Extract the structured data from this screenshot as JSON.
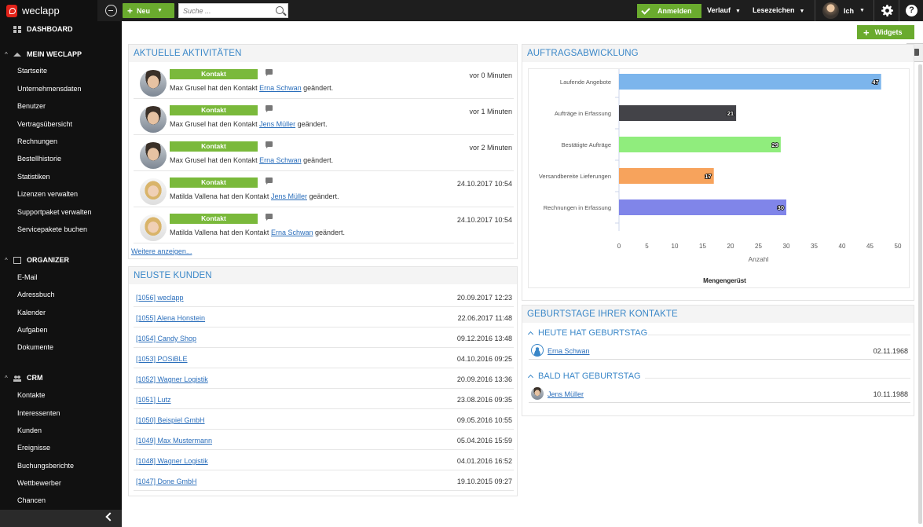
{
  "topbar": {
    "logo_text": "weclapp",
    "new_label": "Neu",
    "search_placeholder": "Suche ...",
    "login_label": "Anmelden",
    "history_label": "Verlauf",
    "bookmarks_label": "Lesezeichen",
    "user_label": "Ich",
    "help_label": "?"
  },
  "sidebar": {
    "dashboard_label": "DASHBOARD",
    "sections": [
      {
        "title": "MEIN WECLAPP",
        "items": [
          "Startseite",
          "Unternehmensdaten",
          "Benutzer",
          "Vertragsübersicht",
          "Rechnungen",
          "Bestellhistorie",
          "Statistiken",
          "Lizenzen verwalten",
          "Supportpaket verwalten",
          "Servicepakete buchen"
        ]
      },
      {
        "title": "ORGANIZER",
        "items": [
          "E-Mail",
          "Adressbuch",
          "Kalender",
          "Aufgaben",
          "Dokumente"
        ]
      },
      {
        "title": "CRM",
        "items": [
          "Kontakte",
          "Interessenten",
          "Kunden",
          "Ereignisse",
          "Buchungsberichte",
          "Wettbewerber",
          "Chancen"
        ]
      }
    ]
  },
  "main": {
    "widgets_label": "Widgets"
  },
  "activities": {
    "title": "AKTUELLE AKTIVITÄTEN",
    "more_label": "Weitere anzeigen...",
    "items": [
      {
        "tag": "Kontakt",
        "time": "vor 0 Minuten",
        "actor": "Max Grusel",
        "text_before": " hat den Kontakt ",
        "contact": "Erna Schwan",
        "text_after": " geändert.",
        "avatar": "male"
      },
      {
        "tag": "Kontakt",
        "time": "vor 1 Minuten",
        "actor": "Max Grusel",
        "text_before": " hat den Kontakt ",
        "contact": "Jens Müller",
        "text_after": " geändert.",
        "avatar": "male"
      },
      {
        "tag": "Kontakt",
        "time": "vor 2 Minuten",
        "actor": "Max Grusel",
        "text_before": " hat den Kontakt ",
        "contact": "Erna Schwan",
        "text_after": " geändert.",
        "avatar": "male"
      },
      {
        "tag": "Kontakt",
        "time": "24.10.2017 10:54",
        "actor": "Matilda Vallena",
        "text_before": " hat den Kontakt ",
        "contact": "Jens Müller",
        "text_after": " geändert.",
        "avatar": "female"
      },
      {
        "tag": "Kontakt",
        "time": "24.10.2017 10:54",
        "actor": "Matilda Vallena",
        "text_before": " hat den Kontakt ",
        "contact": "Erna Schwan",
        "text_after": " geändert.",
        "avatar": "female"
      }
    ]
  },
  "customers": {
    "title": "NEUSTE KUNDEN",
    "rows": [
      {
        "name": "[1056] weclapp",
        "date": "20.09.2017 12:23"
      },
      {
        "name": "[1055] Alena Honstein",
        "date": "22.06.2017 11:48"
      },
      {
        "name": "[1054] Candy Shop",
        "date": "09.12.2016 13:48"
      },
      {
        "name": "[1053] POSiBLE",
        "date": "04.10.2016 09:25"
      },
      {
        "name": "[1052] Wagner Logistik",
        "date": "20.09.2016 13:36"
      },
      {
        "name": "[1051] Lutz",
        "date": "23.08.2016 09:35"
      },
      {
        "name": "[1050] Beispiel GmbH",
        "date": "09.05.2016 10:55"
      },
      {
        "name": "[1049] Max Mustermann",
        "date": "05.04.2016 15:59"
      },
      {
        "name": "[1048] Wagner Logistik",
        "date": "04.01.2016 16:52"
      },
      {
        "name": "[1047] Done GmbH",
        "date": "19.10.2015 09:27"
      }
    ]
  },
  "orders": {
    "title": "AUFTRAGSABWICKLUNG"
  },
  "chart_data": {
    "type": "bar",
    "orientation": "horizontal",
    "categories": [
      "Laufende Angebote",
      "Aufträge in Erfassung",
      "Bestätigte Aufträge",
      "Versandbereite Lieferungen",
      "Rechnungen in Erfassung"
    ],
    "values": [
      47,
      21,
      29,
      17,
      30
    ],
    "colors": [
      "#7cb5ec",
      "#434348",
      "#90ed7d",
      "#f7a35c",
      "#8085e9"
    ],
    "xlabel": "Anzahl",
    "footer": "Mengengerüst",
    "xlim": [
      0,
      50
    ],
    "xticks": [
      0,
      5,
      10,
      15,
      20,
      25,
      30,
      35,
      40,
      45,
      50
    ],
    "data_labels": true,
    "grid": false
  },
  "birthdays": {
    "title": "GEBURTSTAGE IHRER KONTAKTE",
    "today_label": "HEUTE HAT GEBURTSTAG",
    "soon_label": "BALD HAT GEBURTSTAG",
    "today": [
      {
        "name": "Erna Schwan",
        "date": "02.11.1968"
      }
    ],
    "soon": [
      {
        "name": "Jens Müller",
        "date": "10.11.1988"
      }
    ]
  },
  "colors": {
    "accent_green": "#6aab2e",
    "heading_blue": "#3a87c8",
    "link_blue": "#2a6ebb"
  }
}
